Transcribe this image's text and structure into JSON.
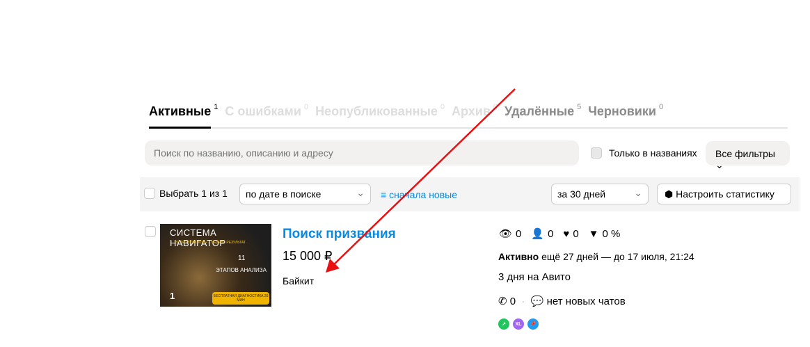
{
  "tabs": [
    {
      "label": "Активные",
      "count": "1"
    },
    {
      "label": "С ошибками",
      "count": "0"
    },
    {
      "label": "Неопубликованные",
      "count": "0"
    },
    {
      "label": "Архив",
      "count": "0"
    },
    {
      "label": "Удалённые",
      "count": "5"
    },
    {
      "label": "Черновики",
      "count": "0"
    }
  ],
  "search": {
    "placeholder": "Поиск по названию, описанию и адресу",
    "only_titles": "Только в названиях",
    "all_filters": "Все фильтры"
  },
  "toolbar": {
    "select": "Выбрать 1 из 1",
    "sort": "по дате в поиске",
    "order": "сначала новые",
    "period": "за 30 дней",
    "stats": "Настроить статистику"
  },
  "item": {
    "image_text": [
      "СИСТЕМА НАВИГАТОР",
      "30 ЛЕТ ПОИСКОВ • 3 НЕДЕЛИ РЕЗУЛЬТАТ",
      "11",
      "ЭТАПОВ АНАЛИЗА",
      "1",
      "БЕСПЛАТНАЯ ДИАГНОСТИКА 20 МИН"
    ],
    "title": "Поиск призвания",
    "price": "15 000 ₽",
    "city": "Байкит",
    "views": "0",
    "contacts": "0",
    "favorites": "0",
    "conversion": "0 %",
    "status": "Активно",
    "status_rest": "ещё 27 дней — до 17 июля, 21:24",
    "days": "3 дня на Авито",
    "calls": "0",
    "chats": "нет новых чатов",
    "badges": [
      {
        "icon": "arrow-up-right",
        "color": "#22c55e"
      },
      {
        "label": "XL",
        "color": "#a066f0"
      },
      {
        "icon": "pin",
        "color": "#1e9bf0"
      }
    ]
  },
  "colors": {
    "accent": "#0a8ae0",
    "arrow": "#e81010"
  }
}
